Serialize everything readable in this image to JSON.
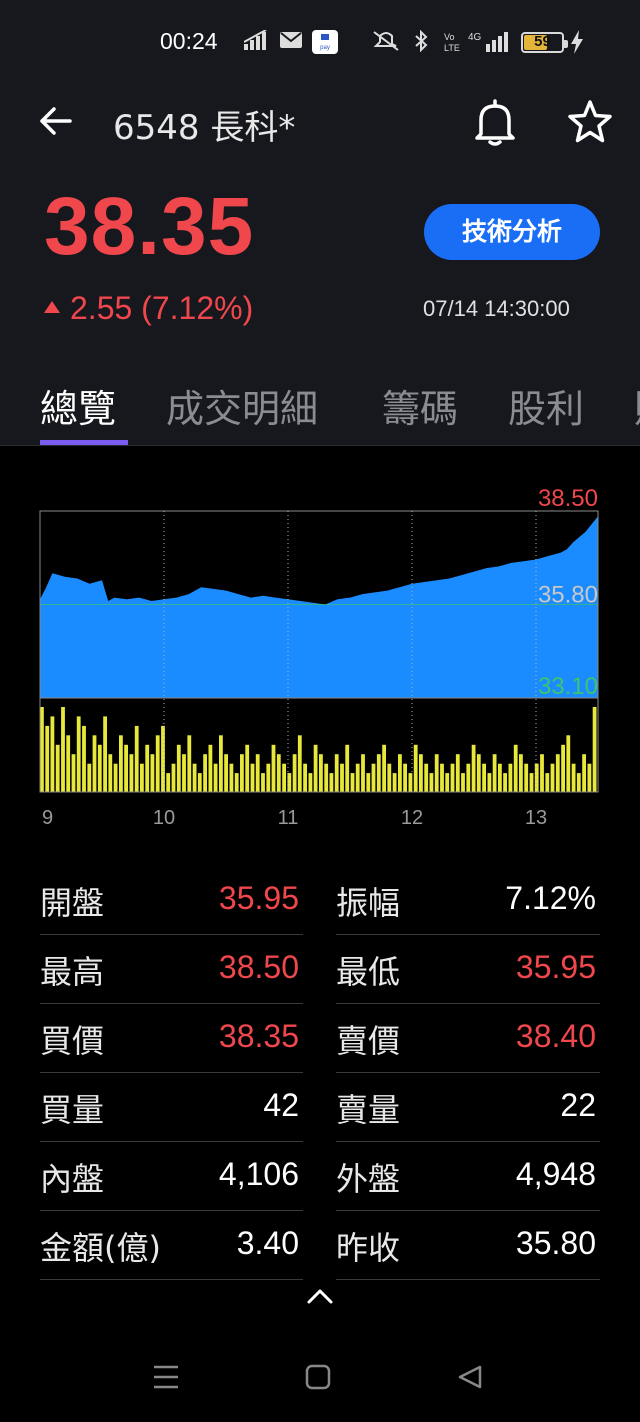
{
  "status_bar": {
    "time": "00:24",
    "battery": "59",
    "icons": [
      "signal-bars-icon",
      "mail-icon",
      "pxpay-icon",
      "mute-icon",
      "bluetooth-icon",
      "volte-icon",
      "4g-signal-icon",
      "battery-icon",
      "charging-icon"
    ]
  },
  "header": {
    "title": "6548 長科*",
    "icons": [
      "back-arrow-icon",
      "bell-icon",
      "star-icon"
    ]
  },
  "quote": {
    "price": "38.35",
    "change": "2.55 (7.12%)",
    "datetime": "07/14 14:30:00",
    "button": "技術分析"
  },
  "tabs": [
    "總覽",
    "成交明細",
    "籌碼",
    "股利",
    "財"
  ],
  "colors": {
    "up": "#f0474d",
    "area": "#1a8cff",
    "volume": "#e8e83a",
    "accent": "#7b5cf0",
    "button": "#1a6ef5"
  },
  "chart_data": {
    "type": "area",
    "y_labels": {
      "high": "38.50",
      "mid": "35.80",
      "low": "33.10"
    },
    "ylim": [
      33.1,
      38.5
    ],
    "x_tick_labels": [
      "9",
      "10",
      "11",
      "12",
      "13"
    ],
    "x_hours": [
      9,
      10,
      11,
      12,
      13
    ],
    "series": [
      {
        "x": [
          9.0,
          9.05,
          9.1,
          9.2,
          9.3,
          9.4,
          9.5,
          9.55,
          9.6,
          9.7,
          9.8,
          9.9,
          10.0,
          10.1,
          10.2,
          10.3,
          10.4,
          10.5,
          10.6,
          10.7,
          10.8,
          10.9,
          11.0,
          11.1,
          11.2,
          11.3,
          11.4,
          11.5,
          11.6,
          11.7,
          11.8,
          11.9,
          12.0,
          12.1,
          12.2,
          12.3,
          12.4,
          12.5,
          12.6,
          12.7,
          12.8,
          12.9,
          13.0,
          13.1,
          13.2,
          13.25,
          13.3,
          13.4,
          13.5
        ],
        "y": [
          35.95,
          36.3,
          36.7,
          36.6,
          36.55,
          36.4,
          36.5,
          35.9,
          36.0,
          35.95,
          36.0,
          35.9,
          35.95,
          36.0,
          36.1,
          36.3,
          36.25,
          36.2,
          36.1,
          36.0,
          36.05,
          36.0,
          35.95,
          35.9,
          35.85,
          35.8,
          35.95,
          36.0,
          36.1,
          36.15,
          36.2,
          36.3,
          36.4,
          36.45,
          36.5,
          36.55,
          36.65,
          36.75,
          36.85,
          36.9,
          37.0,
          37.05,
          37.1,
          37.2,
          37.3,
          37.4,
          37.6,
          37.9,
          38.35
        ]
      }
    ],
    "volume_values": [
      9,
      7,
      8,
      5,
      9,
      6,
      4,
      8,
      7,
      3,
      6,
      5,
      8,
      4,
      3,
      6,
      5,
      4,
      7,
      3,
      5,
      4,
      6,
      7,
      2,
      3,
      5,
      4,
      6,
      3,
      2,
      4,
      5,
      3,
      6,
      4,
      3,
      2,
      4,
      5,
      3,
      4,
      2,
      3,
      5,
      4,
      3,
      2,
      4,
      6,
      3,
      2,
      5,
      4,
      3,
      2,
      4,
      3,
      5,
      2,
      3,
      4,
      2,
      3,
      4,
      5,
      3,
      2,
      4,
      3,
      2,
      5,
      4,
      3,
      2,
      4,
      3,
      2,
      3,
      4,
      2,
      3,
      5,
      4,
      3,
      2,
      4,
      3,
      2,
      3,
      5,
      4,
      3,
      2,
      3,
      4,
      2,
      3,
      4,
      5,
      6,
      3,
      2,
      4,
      3,
      9
    ]
  },
  "stats": [
    {
      "left_label": "開盤",
      "left_value": "35.95",
      "right_label": "振幅",
      "right_value": "7.12%"
    },
    {
      "left_label": "最高",
      "left_value": "38.50",
      "right_label": "最低",
      "right_value": "35.95"
    },
    {
      "left_label": "買價",
      "left_value": "38.35",
      "right_label": "賣價",
      "right_value": "38.40"
    },
    {
      "left_label": "買量",
      "left_value": "42",
      "right_label": "賣量",
      "right_value": "22"
    },
    {
      "left_label": "內盤",
      "left_value": "4,106",
      "right_label": "外盤",
      "right_value": "4,948"
    },
    {
      "left_label": "金額(億)",
      "left_value": "3.40",
      "right_label": "昨收",
      "right_value": "35.80"
    }
  ],
  "stat_colors": [
    [
      "red",
      "white"
    ],
    [
      "red",
      "red"
    ],
    [
      "red",
      "red"
    ],
    [
      "white",
      "white"
    ],
    [
      "white",
      "white"
    ],
    [
      "white",
      "white"
    ]
  ]
}
